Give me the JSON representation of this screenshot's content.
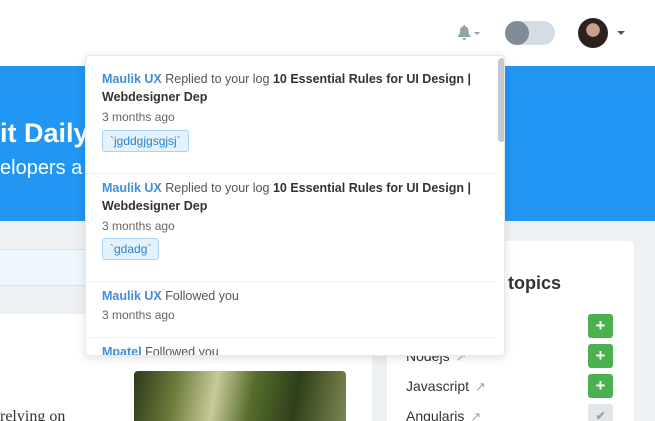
{
  "header": {
    "icons": [
      "bell-icon",
      "chevron-down-icon",
      "theme-toggle",
      "avatar",
      "chevron-down-icon"
    ]
  },
  "hero": {
    "title": "it Daily",
    "subtitle": "elopers a"
  },
  "notifications": [
    {
      "user": "Maulik UX",
      "action": "Replied to your log",
      "post": "10 Essential Rules for UI Design | Webdesigner Dep",
      "time": "3 months ago",
      "tag": "`jgddgjgsgjsj`"
    },
    {
      "user": "Maulik UX",
      "action": "Replied to your log",
      "post": "10 Essential Rules for UI Design | Webdesigner Dep",
      "time": "3 months ago",
      "tag": "`gdadg`"
    },
    {
      "user": "Maulik UX",
      "action": "Followed you",
      "time": "3 months ago"
    },
    {
      "user": "Mpatel",
      "action": "Followed you"
    }
  ],
  "trending": {
    "title": "topics",
    "topics": [
      {
        "name": "Nodejs",
        "followed": false
      },
      {
        "name": "Javascript",
        "followed": false
      },
      {
        "name": "Angularjs",
        "followed": true
      }
    ],
    "follow_label": "+",
    "followed_label": "✔"
  },
  "article": {
    "snippet": "relying on"
  },
  "colors": {
    "accent": "#2196f3",
    "link": "#3f8fd6",
    "success": "#4caf50",
    "tag_bg": "#e3f2fd"
  }
}
